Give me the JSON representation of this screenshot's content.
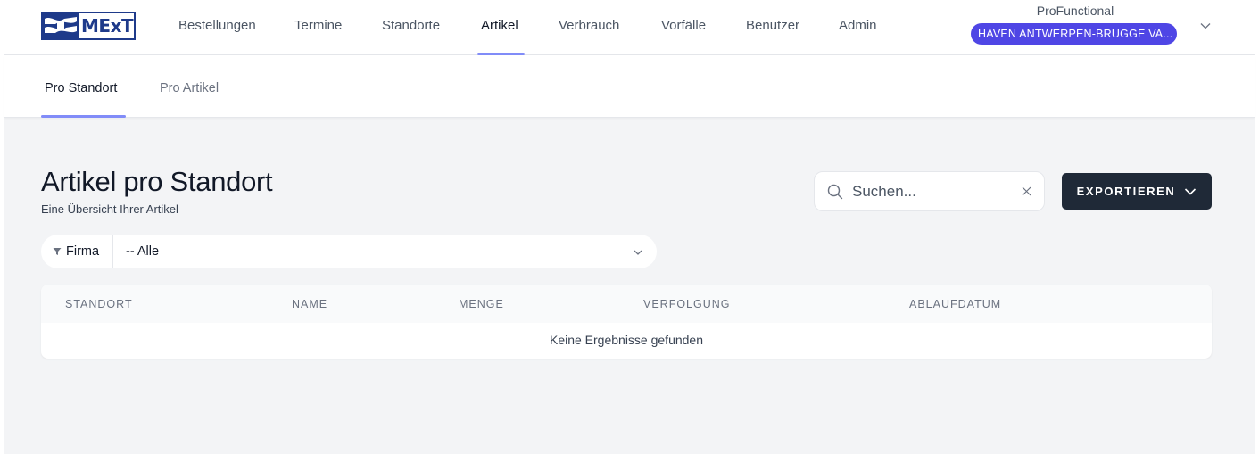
{
  "brand": {
    "logo_text": "MExT",
    "accent": "#4f46e5",
    "underline": "#818cf8",
    "dark": "#1f2937"
  },
  "nav": {
    "items": [
      {
        "label": "Bestellungen"
      },
      {
        "label": "Termine"
      },
      {
        "label": "Standorte"
      },
      {
        "label": "Artikel",
        "active": true
      },
      {
        "label": "Verbrauch"
      },
      {
        "label": "Vorfälle"
      },
      {
        "label": "Benutzer"
      },
      {
        "label": "Admin"
      }
    ]
  },
  "account": {
    "name": "ProFunctional",
    "organization": "HAVEN ANTWERPEN-BRUGGE VA...",
    "chevron_icon": "chevron-down-icon"
  },
  "subnav": {
    "items": [
      {
        "label": "Pro Standort",
        "active": true
      },
      {
        "label": "Pro Artikel"
      }
    ]
  },
  "page": {
    "title": "Artikel pro Standort",
    "subtitle": "Eine Übersicht Ihrer Artikel"
  },
  "search": {
    "placeholder": "Suchen...",
    "value": "",
    "icon": "search-icon",
    "clear_icon": "close-icon"
  },
  "export": {
    "label": "EXPORTIEREN",
    "icon": "chevron-down-icon"
  },
  "filter": {
    "label": "Firma",
    "value": "-- Alle",
    "icon": "filter-icon"
  },
  "table": {
    "columns": [
      "STANDORT",
      "NAME",
      "MENGE",
      "VERFOLGUNG",
      "ABLAUFDATUM"
    ],
    "rows": [],
    "empty_message": "Keine Ergebnisse gefunden"
  }
}
